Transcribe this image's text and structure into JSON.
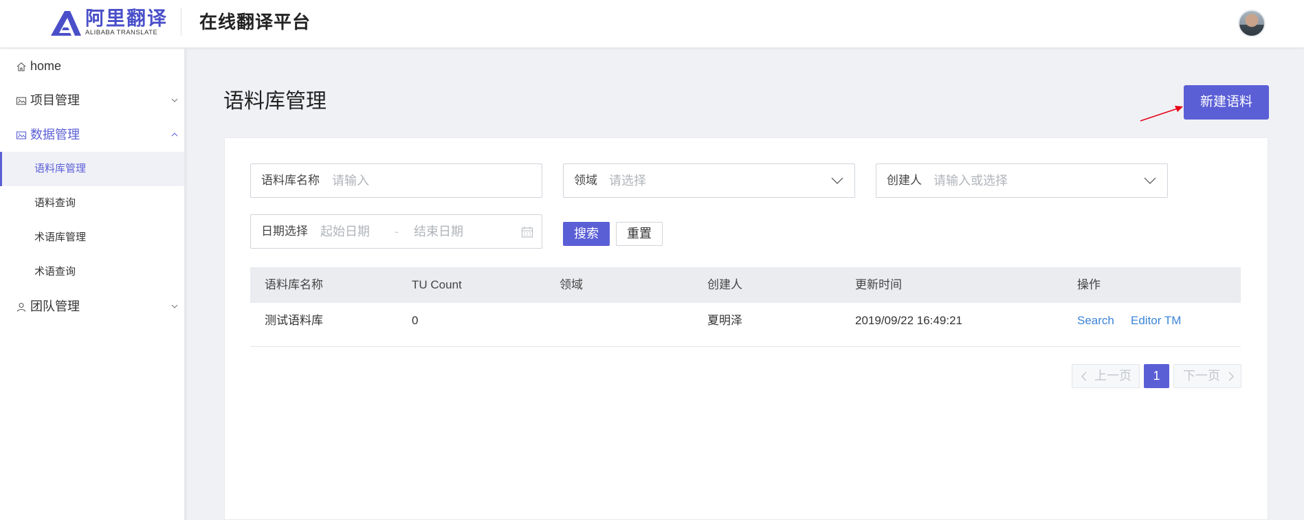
{
  "header": {
    "logo_cn": "阿里翻译",
    "logo_en": "ALIBABA TRANSLATE",
    "platform_title": "在线翻译平台"
  },
  "sidebar": {
    "items": [
      {
        "label": "home",
        "icon": "home-icon"
      },
      {
        "label": "项目管理",
        "icon": "image-icon"
      },
      {
        "label": "数据管理",
        "icon": "image-icon"
      },
      {
        "label": "团队管理",
        "icon": "user-icon"
      }
    ],
    "sub_items": [
      {
        "label": "语料库管理"
      },
      {
        "label": "语料查询"
      },
      {
        "label": "术语库管理"
      },
      {
        "label": "术语查询"
      }
    ]
  },
  "main": {
    "page_title": "语料库管理",
    "new_button": "新建语料"
  },
  "filters": {
    "name": {
      "label": "语料库名称",
      "placeholder": "请输入"
    },
    "domain": {
      "label": "领域",
      "placeholder": "请选择"
    },
    "creator": {
      "label": "创建人",
      "placeholder": "请输入或选择"
    },
    "date": {
      "label": "日期选择",
      "start_placeholder": "起始日期",
      "separator": "-",
      "end_placeholder": "结束日期"
    },
    "search_button": "搜索",
    "reset_button": "重置"
  },
  "table": {
    "headers": [
      "语料库名称",
      "TU Count",
      "领域",
      "创建人",
      "更新时间",
      "操作"
    ],
    "rows": [
      {
        "name": "测试语料库",
        "tu_count": "0",
        "domain": "",
        "creator": "夏明泽",
        "updated": "2019/09/22 16:49:21",
        "actions": [
          "Search",
          "Editor TM"
        ]
      }
    ]
  },
  "pagination": {
    "prev": "上一页",
    "current": "1",
    "next": "下一页"
  },
  "colors": {
    "accent": "#5b5fd6",
    "link": "#3a84d8",
    "annotation_arrow": "#e60012"
  }
}
